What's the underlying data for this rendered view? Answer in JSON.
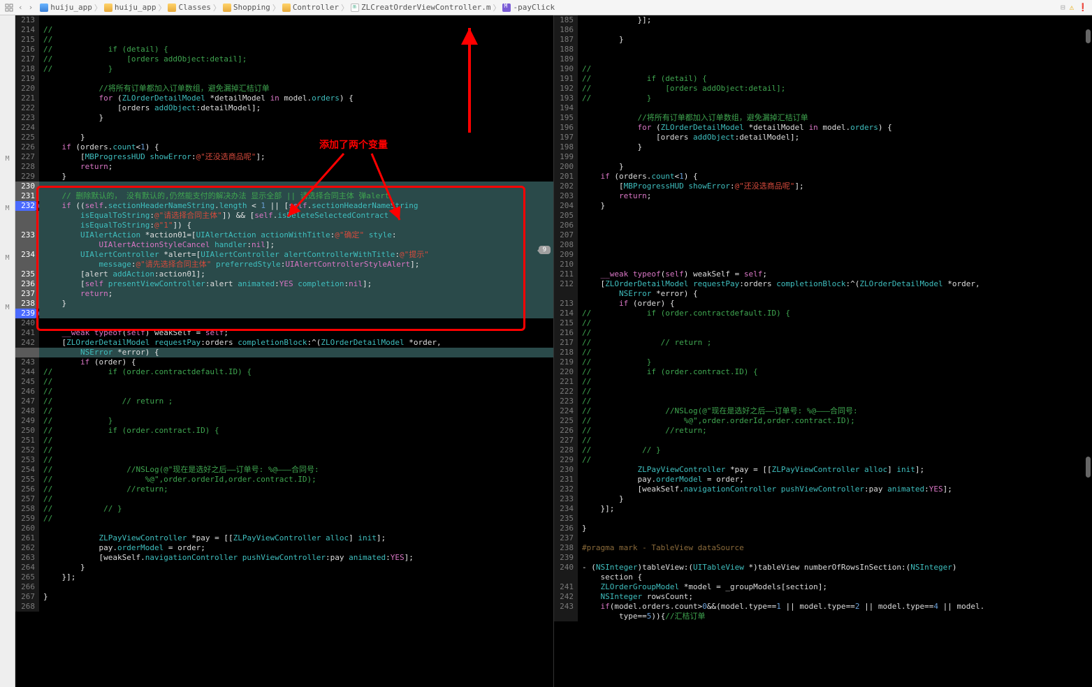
{
  "breadcrumb": {
    "items": [
      {
        "icon": "proj",
        "label": "huiju_app"
      },
      {
        "icon": "folder",
        "label": "huiju_app"
      },
      {
        "icon": "folder",
        "label": "Classes"
      },
      {
        "icon": "folder",
        "label": "Shopping"
      },
      {
        "icon": "folder",
        "label": "Controller"
      },
      {
        "icon": "m",
        "label": "ZLCreatOrderViewController.m"
      },
      {
        "icon": "M",
        "label": "-payClick"
      }
    ]
  },
  "warnings": {
    "warn": "1",
    "err": "1"
  },
  "annotation": "添加了两个变量",
  "pointer_value": "9",
  "mcol": [
    "M",
    "M",
    "M",
    "M"
  ],
  "left": {
    "start": 213,
    "highlight_start": 230,
    "highlight_end": 239,
    "breakpoints": [
      232,
      239
    ],
    "lines": [
      {
        "n": 213,
        "h": ""
      },
      {
        "n": 214,
        "h": "<span class='c-cmt'>//</span>"
      },
      {
        "n": 215,
        "h": "<span class='c-cmt'>//</span>"
      },
      {
        "n": 216,
        "h": "<span class='c-cmt'>//            if (detail) {</span>"
      },
      {
        "n": 217,
        "h": "<span class='c-cmt'>//                [orders addObject:detail];</span>"
      },
      {
        "n": 218,
        "h": "<span class='c-cmt'>//            }</span>"
      },
      {
        "n": 219,
        "h": ""
      },
      {
        "n": 220,
        "h": "            <span class='c-cmt'>//将所有订单都加入订单数组，避免漏掉汇桔订单</span>"
      },
      {
        "n": 221,
        "h": "            <span class='c-kw'>for</span> <span class='c-op'>(</span><span class='c-typ'>ZLOrderDetailModel</span> <span class='c-op'>*</span>detailModel <span class='c-kw'>in</span> model.<span class='c-prop'>orders</span><span class='c-op'>) {</span>"
      },
      {
        "n": 222,
        "h": "                <span class='c-op'>[</span>orders <span class='c-fn'>addObject</span><span class='c-op'>:</span>detailModel<span class='c-op'>];</span>"
      },
      {
        "n": 223,
        "h": "            <span class='c-op'>}</span>"
      },
      {
        "n": 224,
        "h": ""
      },
      {
        "n": 225,
        "h": "        <span class='c-op'>}</span>"
      },
      {
        "n": 226,
        "h": "    <span class='c-kw'>if</span> <span class='c-op'>(</span>orders.<span class='c-prop'>count</span><span class='c-op'>&lt;</span><span class='c-num'>1</span><span class='c-op'>) {</span>"
      },
      {
        "n": 227,
        "h": "        <span class='c-op'>[</span><span class='c-typ'>MBProgressHUD</span> <span class='c-fn'>showError</span><span class='c-op'>:</span><span class='c-str'>@&quot;还没选商品呢&quot;</span><span class='c-op'>];</span>"
      },
      {
        "n": 228,
        "h": "        <span class='c-kw'>return</span><span class='c-op'>;</span>"
      },
      {
        "n": 229,
        "h": "    <span class='c-op'>}</span>"
      },
      {
        "n": 230,
        "h": ""
      },
      {
        "n": 231,
        "h": "    <span class='c-cmt'>// 删除默认的， 没有默认的,仍然能支付的解决办法 显示全部 || 请选择合同主体 弹alert</span>"
      },
      {
        "n": 232,
        "h": "    <span class='c-kw'>if</span> <span class='c-op'>((</span><span class='c-kw'>self</span>.<span class='c-prop'>sectionHeaderNameString</span>.<span class='c-prop'>length</span> <span class='c-op'>&lt;</span> <span class='c-num'>1</span> <span class='c-op'>|| [</span><span class='c-kw'>self</span>.<span class='c-prop'>sectionHeaderNameString</span>"
      },
      {
        "n": 0,
        "h": "        <span class='c-fn'>isEqualToString</span><span class='c-op'>:</span><span class='c-str'>@&quot;请选择合同主体&quot;</span><span class='c-op'>]) &amp;&amp; [</span><span class='c-kw'>self</span>.<span class='c-prop'>isDeleteSelectedContract</span>"
      },
      {
        "n": 0,
        "h": "        <span class='c-fn'>isEqualToString</span><span class='c-op'>:</span><span class='c-str'>@&quot;1&quot;</span><span class='c-op'>]) {</span>"
      },
      {
        "n": 233,
        "h": "        <span class='c-typ'>UIAlertAction</span> <span class='c-op'>*</span>action01<span class='c-op'>=[</span><span class='c-typ'>UIAlertAction</span> <span class='c-fn'>actionWithTitle</span><span class='c-op'>:</span><span class='c-str'>@&quot;确定&quot;</span> <span class='c-fn'>style</span><span class='c-op'>:</span>"
      },
      {
        "n": 0,
        "h": "            <span class='c-const'>UIAlertActionStyleCancel</span> <span class='c-fn'>handler</span><span class='c-op'>:</span><span class='c-kw'>nil</span><span class='c-op'>];</span>"
      },
      {
        "n": 234,
        "h": "        <span class='c-typ'>UIAlertController</span> <span class='c-op'>*</span>alert<span class='c-op'>=[</span><span class='c-typ'>UIAlertController</span> <span class='c-fn'>alertControllerWithTitle</span><span class='c-op'>:</span><span class='c-str'>@&quot;提示&quot;</span>"
      },
      {
        "n": 0,
        "h": "            <span class='c-fn'>message</span><span class='c-op'>:</span><span class='c-str'>@&quot;请先选择合同主体&quot;</span> <span class='c-fn'>preferredStyle</span><span class='c-op'>:</span><span class='c-const'>UIAlertControllerStyleAlert</span><span class='c-op'>];</span>"
      },
      {
        "n": 235,
        "h": "        <span class='c-op'>[</span>alert <span class='c-fn'>addAction</span><span class='c-op'>:</span>action01<span class='c-op'>];</span>"
      },
      {
        "n": 236,
        "h": "        <span class='c-op'>[</span><span class='c-kw'>self</span> <span class='c-fn'>presentViewController</span><span class='c-op'>:</span>alert <span class='c-fn'>animated</span><span class='c-op'>:</span><span class='c-kw'>YES</span> <span class='c-fn'>completion</span><span class='c-op'>:</span><span class='c-kw'>nil</span><span class='c-op'>];</span>"
      },
      {
        "n": 237,
        "h": "        <span class='c-kw'>return</span><span class='c-op'>;</span>"
      },
      {
        "n": 238,
        "h": "    <span class='c-op'>}</span>"
      },
      {
        "n": 239,
        "h": ""
      },
      {
        "n": 240,
        "h": ""
      },
      {
        "n": 241,
        "h": "    <span class='c-kw'>__weak</span> <span class='c-kw'>typeof</span><span class='c-op'>(</span><span class='c-kw'>self</span><span class='c-op'>)</span> weakSelf <span class='c-op'>=</span> <span class='c-kw'>self</span><span class='c-op'>;</span>"
      },
      {
        "n": 242,
        "h": "    <span class='c-op'>[</span><span class='c-typ'>ZLOrderDetailModel</span> <span class='c-fn'>requestPay</span><span class='c-op'>:</span>orders <span class='c-fn'>completionBlock</span><span class='c-op'>:^(</span><span class='c-typ'>ZLOrderDetailModel</span> <span class='c-op'>*</span>order,"
      },
      {
        "n": 0,
        "h": "        <span class='c-typ'>NSError</span> <span class='c-op'>*</span>error<span class='c-op'>) {</span>"
      },
      {
        "n": 243,
        "h": "        <span class='c-kw'>if</span> <span class='c-op'>(</span>order<span class='c-op'>) {</span>"
      },
      {
        "n": 244,
        "h": "<span class='c-cmt'>//            if (order.contractdefault.ID) {</span>"
      },
      {
        "n": 245,
        "h": "<span class='c-cmt'>//</span>"
      },
      {
        "n": 246,
        "h": "<span class='c-cmt'>//</span>"
      },
      {
        "n": 247,
        "h": "<span class='c-cmt'>//               // return ;</span>"
      },
      {
        "n": 248,
        "h": "<span class='c-cmt'>//</span>"
      },
      {
        "n": 249,
        "h": "<span class='c-cmt'>//            }</span>"
      },
      {
        "n": 250,
        "h": "<span class='c-cmt'>//            if (order.contract.ID) {</span>"
      },
      {
        "n": 251,
        "h": "<span class='c-cmt'>//</span>"
      },
      {
        "n": 252,
        "h": "<span class='c-cmt'>//</span>"
      },
      {
        "n": 253,
        "h": "<span class='c-cmt'>//</span>"
      },
      {
        "n": 254,
        "h": "<span class='c-cmt'>//                //NSLog(@&quot;现在是选好之后——订单号: %@———合同号:</span>"
      },
      {
        "n": 255,
        "h": "<span class='c-cmt'>//                    %@&quot;,order.orderId,order.contract.ID);</span>"
      },
      {
        "n": 256,
        "h": "<span class='c-cmt'>//                //return;</span>"
      },
      {
        "n": 257,
        "h": "<span class='c-cmt'>//</span>"
      },
      {
        "n": 258,
        "h": "<span class='c-cmt'>//           // }</span>"
      },
      {
        "n": 259,
        "h": "<span class='c-cmt'>//</span>"
      },
      {
        "n": 260,
        "h": ""
      },
      {
        "n": 261,
        "h": "            <span class='c-typ'>ZLPayViewController</span> <span class='c-op'>*</span>pay <span class='c-op'>= [[</span><span class='c-typ'>ZLPayViewController</span> <span class='c-fn'>alloc</span><span class='c-op'>]</span> <span class='c-fn'>init</span><span class='c-op'>];</span>"
      },
      {
        "n": 262,
        "h": "            pay.<span class='c-prop'>orderModel</span> <span class='c-op'>=</span> order<span class='c-op'>;</span>"
      },
      {
        "n": 263,
        "h": "            <span class='c-op'>[</span>weakSelf.<span class='c-prop'>navigationController</span> <span class='c-fn'>pushViewController</span><span class='c-op'>:</span>pay <span class='c-fn'>animated</span><span class='c-op'>:</span><span class='c-kw'>YES</span><span class='c-op'>];</span>"
      },
      {
        "n": 264,
        "h": "        <span class='c-op'>}</span>"
      },
      {
        "n": 265,
        "h": "    <span class='c-op'>}];</span>"
      },
      {
        "n": 266,
        "h": ""
      },
      {
        "n": 267,
        "h": "<span class='c-op'>}</span>"
      },
      {
        "n": 268,
        "h": ""
      }
    ]
  },
  "right": {
    "start": 185,
    "lines": [
      {
        "n": 185,
        "h": "            <span class='c-op'>}];</span>"
      },
      {
        "n": 186,
        "h": ""
      },
      {
        "n": 187,
        "h": "        <span class='c-op'>}</span>"
      },
      {
        "n": 188,
        "h": ""
      },
      {
        "n": 189,
        "h": ""
      },
      {
        "n": 190,
        "h": "<span class='c-cmt'>//</span>"
      },
      {
        "n": 191,
        "h": "<span class='c-cmt'>//            if (detail) {</span>"
      },
      {
        "n": 192,
        "h": "<span class='c-cmt'>//                [orders addObject:detail];</span>"
      },
      {
        "n": 193,
        "h": "<span class='c-cmt'>//            }</span>"
      },
      {
        "n": 194,
        "h": ""
      },
      {
        "n": 195,
        "h": "            <span class='c-cmt'>//将所有订单都加入订单数组，避免漏掉汇桔订单</span>"
      },
      {
        "n": 196,
        "h": "            <span class='c-kw'>for</span> <span class='c-op'>(</span><span class='c-typ'>ZLOrderDetailModel</span> <span class='c-op'>*</span>detailModel <span class='c-kw'>in</span> model.<span class='c-prop'>orders</span><span class='c-op'>) {</span>"
      },
      {
        "n": 197,
        "h": "                <span class='c-op'>[</span>orders <span class='c-fn'>addObject</span><span class='c-op'>:</span>detailModel<span class='c-op'>];</span>"
      },
      {
        "n": 198,
        "h": "            <span class='c-op'>}</span>"
      },
      {
        "n": 199,
        "h": ""
      },
      {
        "n": 200,
        "h": "        <span class='c-op'>}</span>"
      },
      {
        "n": 201,
        "h": "    <span class='c-kw'>if</span> <span class='c-op'>(</span>orders.<span class='c-prop'>count</span><span class='c-op'>&lt;</span><span class='c-num'>1</span><span class='c-op'>) {</span>"
      },
      {
        "n": 202,
        "h": "        <span class='c-op'>[</span><span class='c-typ'>MBProgressHUD</span> <span class='c-fn'>showError</span><span class='c-op'>:</span><span class='c-str'>@&quot;还没选商品呢&quot;</span><span class='c-op'>];</span>"
      },
      {
        "n": 203,
        "h": "        <span class='c-kw'>return</span><span class='c-op'>;</span>"
      },
      {
        "n": 204,
        "h": "    <span class='c-op'>}</span>"
      },
      {
        "n": 205,
        "h": ""
      },
      {
        "n": 206,
        "h": ""
      },
      {
        "n": 207,
        "h": ""
      },
      {
        "n": 208,
        "h": ""
      },
      {
        "n": 209,
        "h": ""
      },
      {
        "n": 210,
        "h": ""
      },
      {
        "n": 211,
        "h": "    <span class='c-kw'>__weak</span> <span class='c-kw'>typeof</span><span class='c-op'>(</span><span class='c-kw'>self</span><span class='c-op'>)</span> weakSelf <span class='c-op'>=</span> <span class='c-kw'>self</span><span class='c-op'>;</span>"
      },
      {
        "n": 212,
        "h": "    <span class='c-op'>[</span><span class='c-typ'>ZLOrderDetailModel</span> <span class='c-fn'>requestPay</span><span class='c-op'>:</span>orders <span class='c-fn'>completionBlock</span><span class='c-op'>:^(</span><span class='c-typ'>ZLOrderDetailModel</span> <span class='c-op'>*</span>order,"
      },
      {
        "n": 0,
        "h": "        <span class='c-typ'>NSError</span> <span class='c-op'>*</span>error<span class='c-op'>) {</span>"
      },
      {
        "n": 213,
        "h": "        <span class='c-kw'>if</span> <span class='c-op'>(</span>order<span class='c-op'>) {</span>"
      },
      {
        "n": 214,
        "h": "<span class='c-cmt'>//            if (order.contractdefault.ID) {</span>"
      },
      {
        "n": 215,
        "h": "<span class='c-cmt'>//</span>"
      },
      {
        "n": 216,
        "h": "<span class='c-cmt'>//</span>"
      },
      {
        "n": 217,
        "h": "<span class='c-cmt'>//               // return ;</span>"
      },
      {
        "n": 218,
        "h": "<span class='c-cmt'>//</span>"
      },
      {
        "n": 219,
        "h": "<span class='c-cmt'>//            }</span>"
      },
      {
        "n": 220,
        "h": "<span class='c-cmt'>//            if (order.contract.ID) {</span>"
      },
      {
        "n": 221,
        "h": "<span class='c-cmt'>//</span>"
      },
      {
        "n": 222,
        "h": "<span class='c-cmt'>//</span>"
      },
      {
        "n": 223,
        "h": "<span class='c-cmt'>//</span>"
      },
      {
        "n": 224,
        "h": "<span class='c-cmt'>//                //NSLog(@&quot;现在是选好之后——订单号: %@———合同号:</span>"
      },
      {
        "n": 225,
        "h": "<span class='c-cmt'>//                    %@&quot;,order.orderId,order.contract.ID);</span>"
      },
      {
        "n": 226,
        "h": "<span class='c-cmt'>//                //return;</span>"
      },
      {
        "n": 227,
        "h": "<span class='c-cmt'>//</span>"
      },
      {
        "n": 228,
        "h": "<span class='c-cmt'>//           // }</span>"
      },
      {
        "n": 229,
        "h": "<span class='c-cmt'>//</span>"
      },
      {
        "n": 230,
        "h": "            <span class='c-typ'>ZLPayViewController</span> <span class='c-op'>*</span>pay <span class='c-op'>= [[</span><span class='c-typ'>ZLPayViewController</span> <span class='c-fn'>alloc</span><span class='c-op'>]</span> <span class='c-fn'>init</span><span class='c-op'>];</span>"
      },
      {
        "n": 231,
        "h": "            pay.<span class='c-prop'>orderModel</span> <span class='c-op'>=</span> order<span class='c-op'>;</span>"
      },
      {
        "n": 232,
        "h": "            <span class='c-op'>[</span>weakSelf.<span class='c-prop'>navigationController</span> <span class='c-fn'>pushViewController</span><span class='c-op'>:</span>pay <span class='c-fn'>animated</span><span class='c-op'>:</span><span class='c-kw'>YES</span><span class='c-op'>];</span>"
      },
      {
        "n": 233,
        "h": "        <span class='c-op'>}</span>"
      },
      {
        "n": 234,
        "h": "    <span class='c-op'>}];</span>"
      },
      {
        "n": 235,
        "h": ""
      },
      {
        "n": 236,
        "h": "<span class='c-op'>}</span>"
      },
      {
        "n": 237,
        "h": ""
      },
      {
        "n": 238,
        "h": "<span class='c-pragma'>#pragma mark - TableView dataSource</span>"
      },
      {
        "n": 239,
        "h": ""
      },
      {
        "n": 240,
        "h": "<span class='c-op'>- (</span><span class='c-typ'>NSInteger</span><span class='c-op'>)</span>tableView<span class='c-op'>:(</span><span class='c-typ'>UITableView</span> <span class='c-op'>*)</span>tableView numberOfRowsInSection<span class='c-op'>:(</span><span class='c-typ'>NSInteger</span><span class='c-op'>)</span>"
      },
      {
        "n": 0,
        "h": "    section <span class='c-op'>{</span>"
      },
      {
        "n": 241,
        "h": "    <span class='c-typ'>ZLOrderGroupModel</span> <span class='c-op'>*</span>model <span class='c-op'>=</span> _groupModels<span class='c-op'>[</span>section<span class='c-op'>];</span>"
      },
      {
        "n": 242,
        "h": "    <span class='c-typ'>NSInteger</span> rowsCount<span class='c-op'>;</span>"
      },
      {
        "n": 243,
        "h": "    <span class='c-kw'>if</span><span class='c-op'>(</span>model.orders.count<span class='c-op'>&gt;</span><span class='c-num'>0</span><span class='c-op'>&amp;&amp;(</span>model.type<span class='c-op'>==</span><span class='c-num'>1</span> <span class='c-op'>||</span> model.type<span class='c-op'>==</span><span class='c-num'>2</span> <span class='c-op'>||</span> model.type<span class='c-op'>==</span><span class='c-num'>4</span> <span class='c-op'>||</span> model."
      },
      {
        "n": 0,
        "h": "        type<span class='c-op'>==</span><span class='c-num'>5</span><span class='c-op'>)){</span><span class='c-cmt'>//汇桔订单</span>"
      }
    ]
  }
}
